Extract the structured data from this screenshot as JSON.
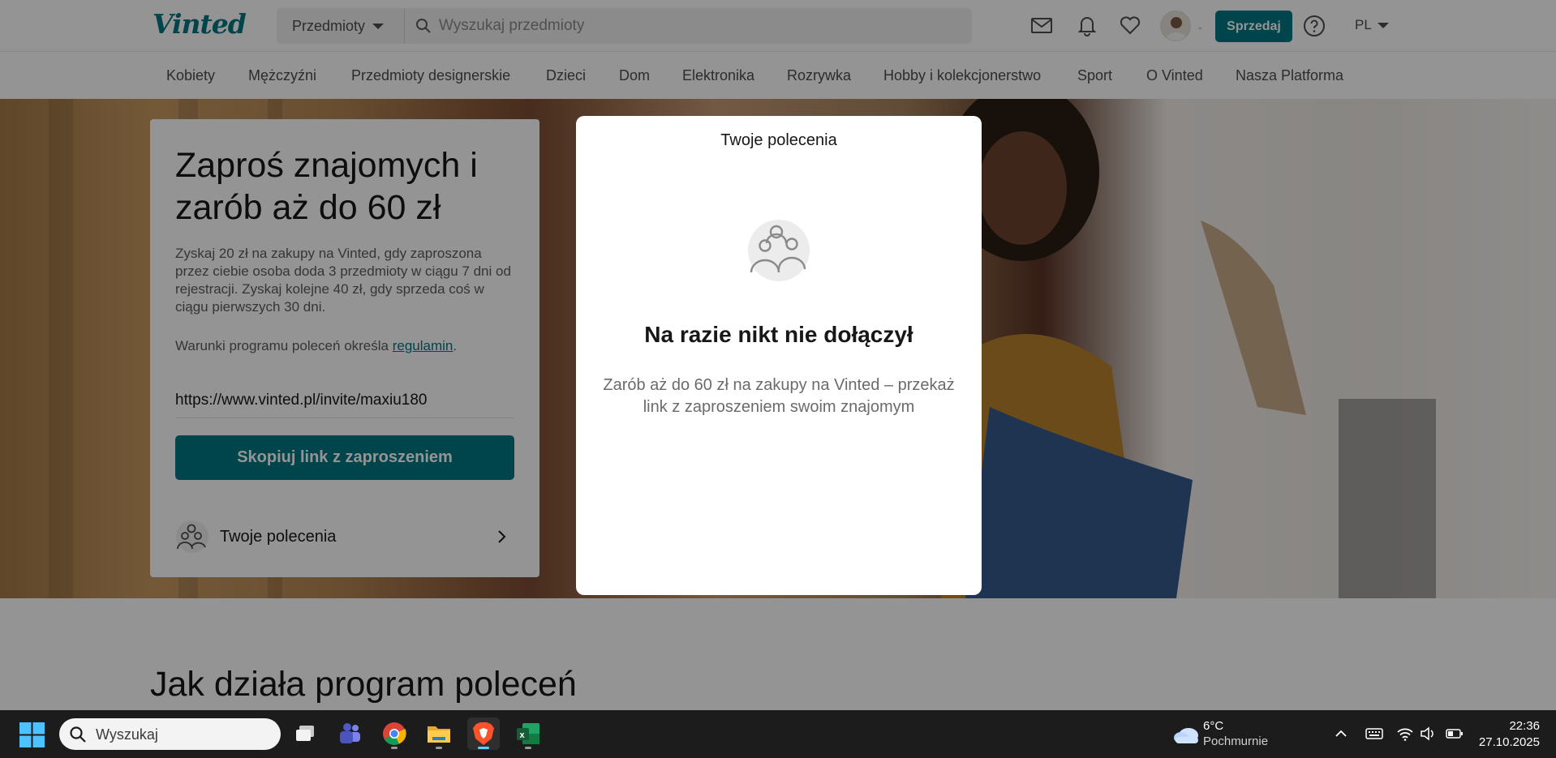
{
  "header": {
    "logo": "Vinted",
    "search_category": "Przedmioty",
    "search_placeholder": "Wyszukaj przedmioty",
    "sell_label": "Sprzedaj",
    "language": "PL"
  },
  "categories": [
    "Kobiety",
    "Mężczyźni",
    "Przedmioty designerskie",
    "Dzieci",
    "Dom",
    "Elektronika",
    "Rozrywka",
    "Hobby i kolekcjonerstwo",
    "Sport",
    "O Vinted",
    "Nasza Platforma"
  ],
  "invite": {
    "title": "Zaproś znajomych i zarób aż do 60 zł",
    "description": "Zyskaj 20 zł na zakupy na Vinted, gdy zaproszona przez ciebie osoba doda 3 przedmioty w ciągu 7 dni od rejestracji. Zyskaj kolejne 40 zł, gdy sprzeda coś w ciągu pierwszych 30 dni.",
    "terms_prefix": "Warunki programu poleceń określa",
    "terms_link": "regulamin",
    "terms_suffix": ".",
    "url": "https://www.vinted.pl/invite/maxiu180",
    "copy_button": "Skopiuj link z zaproszeniem",
    "referrals_label": "Twoje polecenia"
  },
  "section_title": "Jak działa program poleceń",
  "modal": {
    "title": "Twoje polecenia",
    "heading": "Na razie nikt nie dołączył",
    "text": "Zarób aż do 60 zł na zakupy na Vinted – przekaż link z zaproszeniem swoim znajomym"
  },
  "taskbar": {
    "search_placeholder": "Wyszukaj",
    "weather_temp": "6°C",
    "weather_desc": "Pochmurnie",
    "time": "22:36",
    "date": "27.10.2025"
  },
  "colors": {
    "brand": "#007782",
    "overlay": "rgba(0,0,0,0.42)",
    "taskbar": "#1c1c1c"
  },
  "icons": [
    "search-icon",
    "mail-icon",
    "bell-icon",
    "heart-icon",
    "help-icon",
    "people-icon",
    "chevron-right-icon",
    "windows-start-icon",
    "cloud-icon",
    "wifi-icon",
    "volume-icon",
    "battery-icon",
    "keyboard-icon",
    "chevron-up-icon"
  ]
}
